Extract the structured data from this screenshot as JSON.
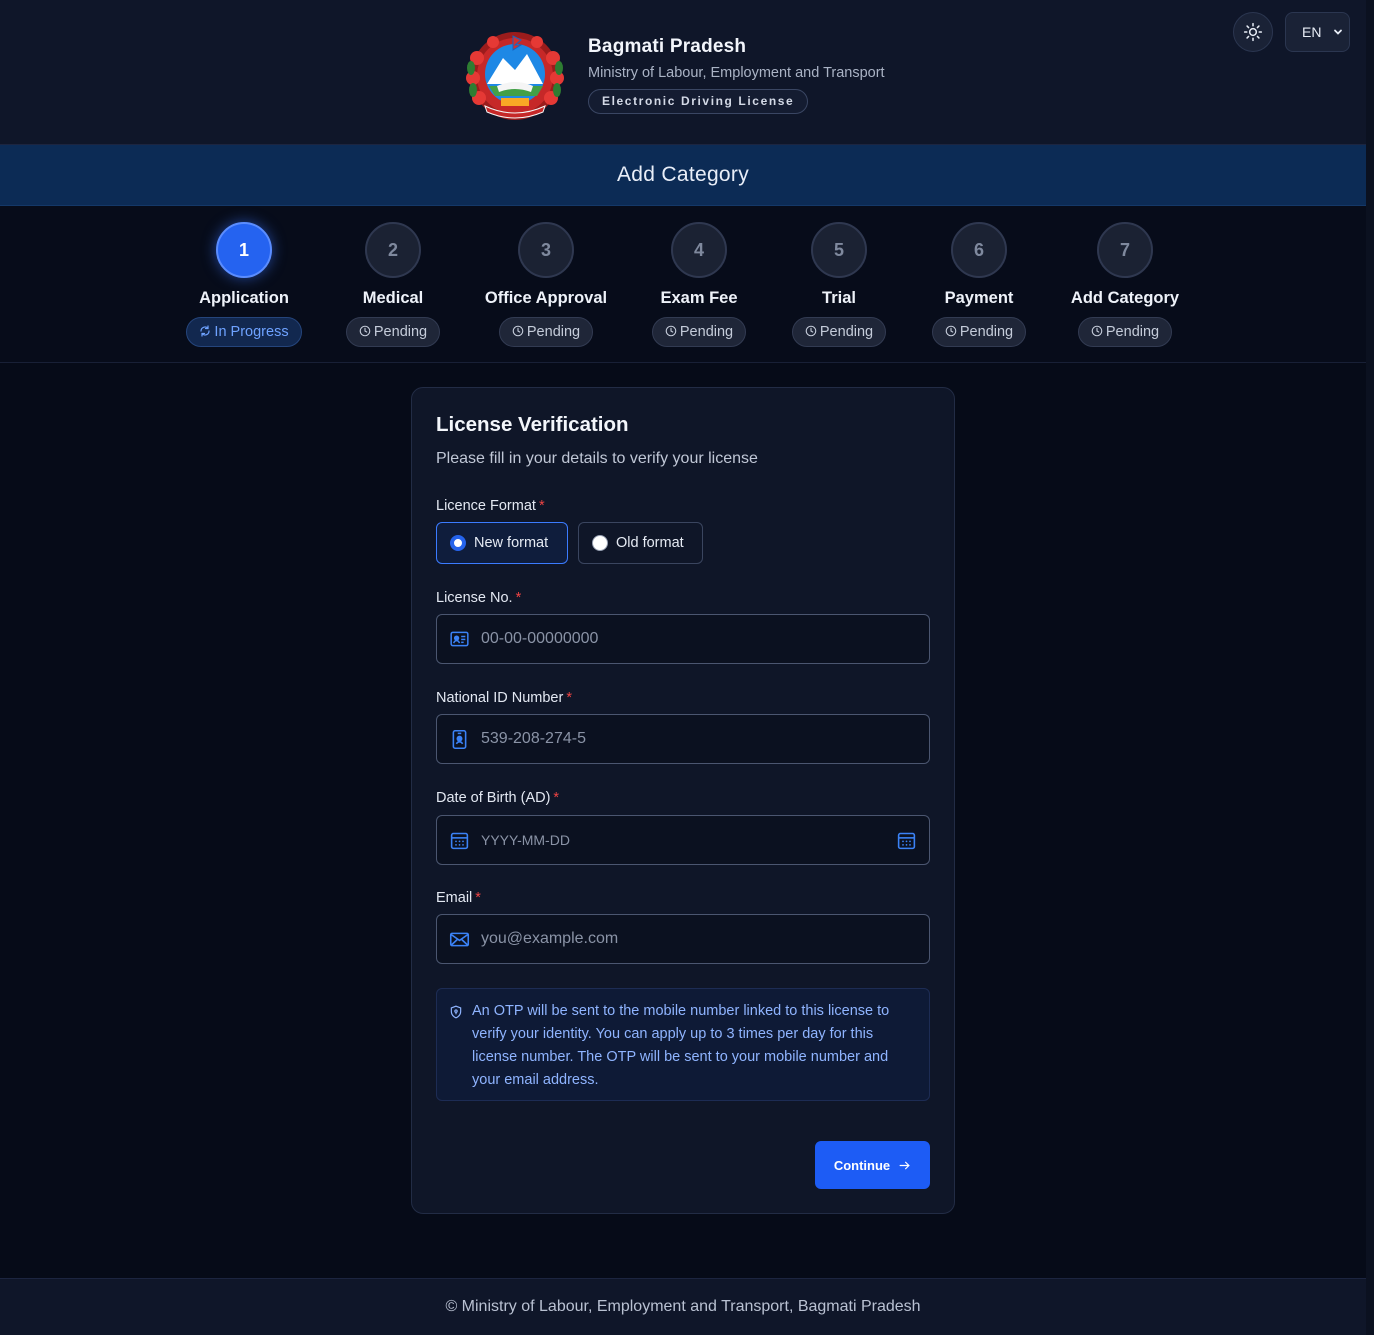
{
  "header": {
    "title": "Bagmati Pradesh",
    "subtitle": "Ministry of Labour, Employment and Transport",
    "badge": "Electronic Driving License",
    "emblem_icon": "nepal-emblem",
    "theme_icon": "sun-icon",
    "language": "EN"
  },
  "page_title": "Add Category",
  "steps": [
    {
      "number": "1",
      "label": "Application",
      "status": "In Progress",
      "active": true
    },
    {
      "number": "2",
      "label": "Medical",
      "status": "Pending"
    },
    {
      "number": "3",
      "label": "Office Approval",
      "status": "Pending"
    },
    {
      "number": "4",
      "label": "Exam Fee",
      "status": "Pending"
    },
    {
      "number": "5",
      "label": "Trial",
      "status": "Pending"
    },
    {
      "number": "6",
      "label": "Payment",
      "status": "Pending"
    },
    {
      "number": "7",
      "label": "Add Category",
      "status": "Pending"
    }
  ],
  "form": {
    "title": "License Verification",
    "subtitle": "Please fill in your details to verify your license",
    "licence_format": {
      "label": "Licence Format",
      "options": [
        "New format",
        "Old format"
      ],
      "selected": "New format"
    },
    "license_no": {
      "label": "License No.",
      "placeholder": "00-00-00000000",
      "icon": "id-card-icon"
    },
    "national_id": {
      "label": "National ID Number",
      "placeholder": "539-208-274-5",
      "icon": "id-badge-icon"
    },
    "dob": {
      "label": "Date of Birth (AD)",
      "placeholder": "YYYY-MM-DD",
      "icon": "calendar-icon"
    },
    "email": {
      "label": "Email",
      "placeholder": "you@example.com",
      "icon": "mail-icon"
    },
    "required_marker": "*",
    "otp_note": "An OTP will be sent to the mobile number linked to this license to verify your identity. You can apply up to 3 times per day for this license number. The OTP will be sent to your mobile number and your email address.",
    "continue_label": "Continue"
  },
  "footer": "© Ministry of Labour, Employment and Transport, Bagmati Pradesh",
  "colors": {
    "accent": "#1d5cf5",
    "background": "#060b18",
    "card": "#0f1628",
    "title_bar": "#0c2b55",
    "required": "#ef4444"
  }
}
